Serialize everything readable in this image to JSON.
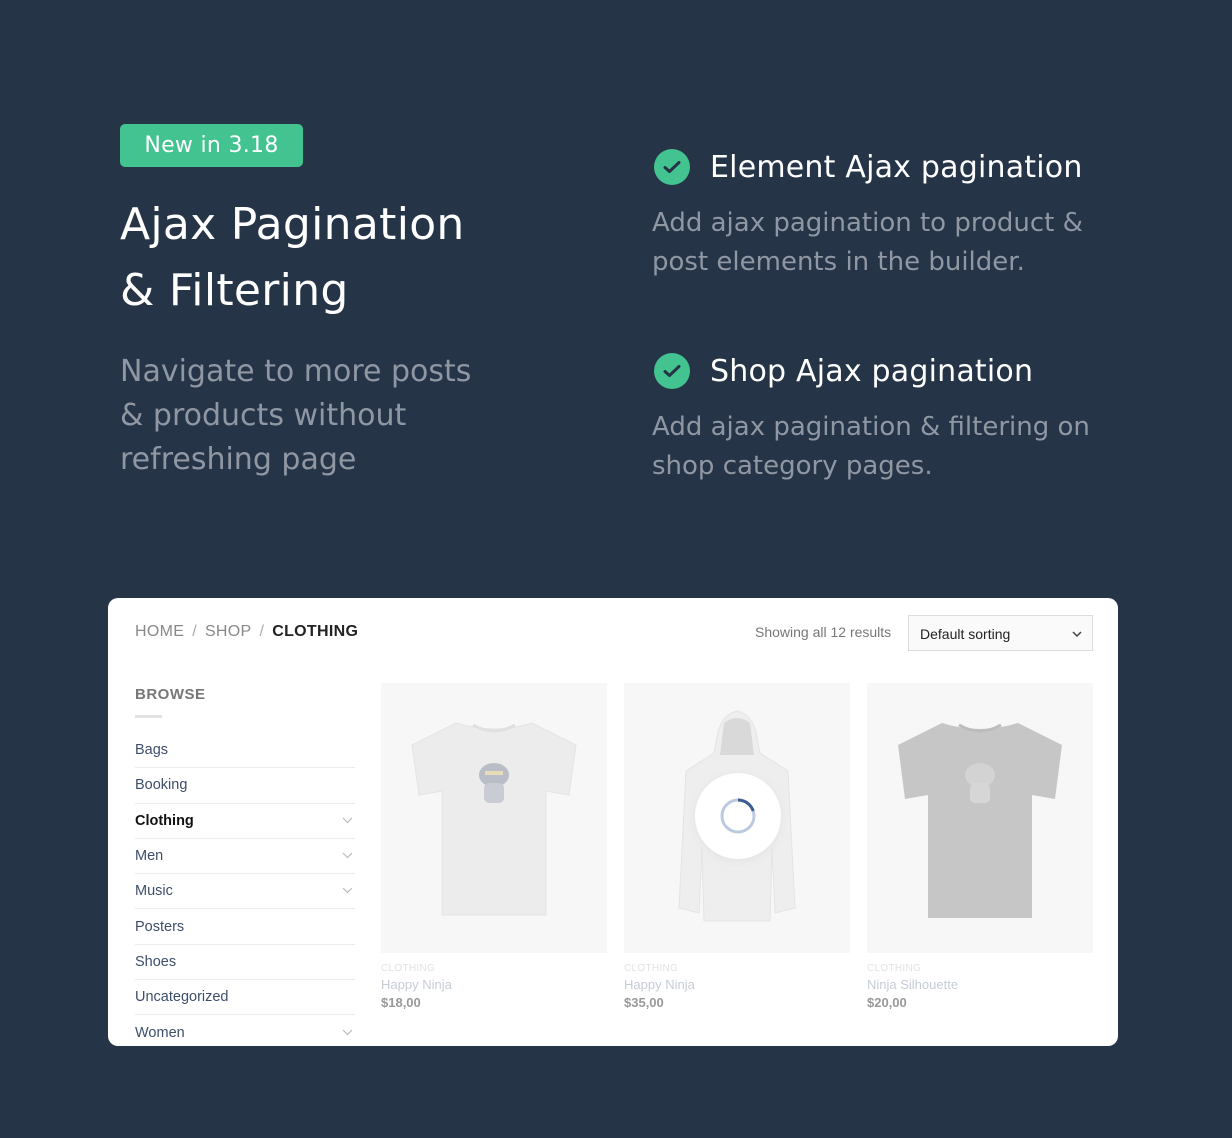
{
  "badge": "New in 3.18",
  "hero": {
    "title_line1": "Ajax Pagination",
    "title_line2": "& Filtering",
    "subtitle": "Navigate to more posts & products without refreshing page"
  },
  "features": [
    {
      "title": "Element Ajax pagination",
      "description": "Add ajax pagination to product & post elements in the builder.",
      "icon": "check-circle-icon"
    },
    {
      "title": "Shop Ajax pagination",
      "description": "Add ajax pagination & filtering on shop category pages.",
      "icon": "check-circle-icon"
    }
  ],
  "colors": {
    "background": "#263447",
    "accent": "#43c390",
    "spinner": "#3d5c94"
  },
  "shop": {
    "breadcrumb": {
      "home": "HOME",
      "shop": "SHOP",
      "current": "CLOTHING",
      "separator": "/"
    },
    "results": "Showing all 12 results",
    "sort": {
      "selected": "Default sorting",
      "icon": "chevron-down-icon"
    },
    "browse_title": "BROWSE",
    "categories": [
      {
        "label": "Bags",
        "expandable": false
      },
      {
        "label": "Booking",
        "expandable": false
      },
      {
        "label": "Clothing",
        "expandable": true,
        "active": true
      },
      {
        "label": "Men",
        "expandable": true
      },
      {
        "label": "Music",
        "expandable": true
      },
      {
        "label": "Posters",
        "expandable": false
      },
      {
        "label": "Shoes",
        "expandable": false
      },
      {
        "label": "Uncategorized",
        "expandable": false
      },
      {
        "label": "Women",
        "expandable": true
      }
    ],
    "products": [
      {
        "category": "CLOTHING",
        "name": "Happy Ninja",
        "price": "$18,00",
        "image": "white-tshirt-ninja"
      },
      {
        "category": "CLOTHING",
        "name": "Happy Ninja",
        "price": "$35,00",
        "image": "white-hoodie",
        "loading": true
      },
      {
        "category": "CLOTHING",
        "name": "Ninja Silhouette",
        "price": "$20,00",
        "image": "grey-tshirt-silhouette"
      }
    ]
  }
}
